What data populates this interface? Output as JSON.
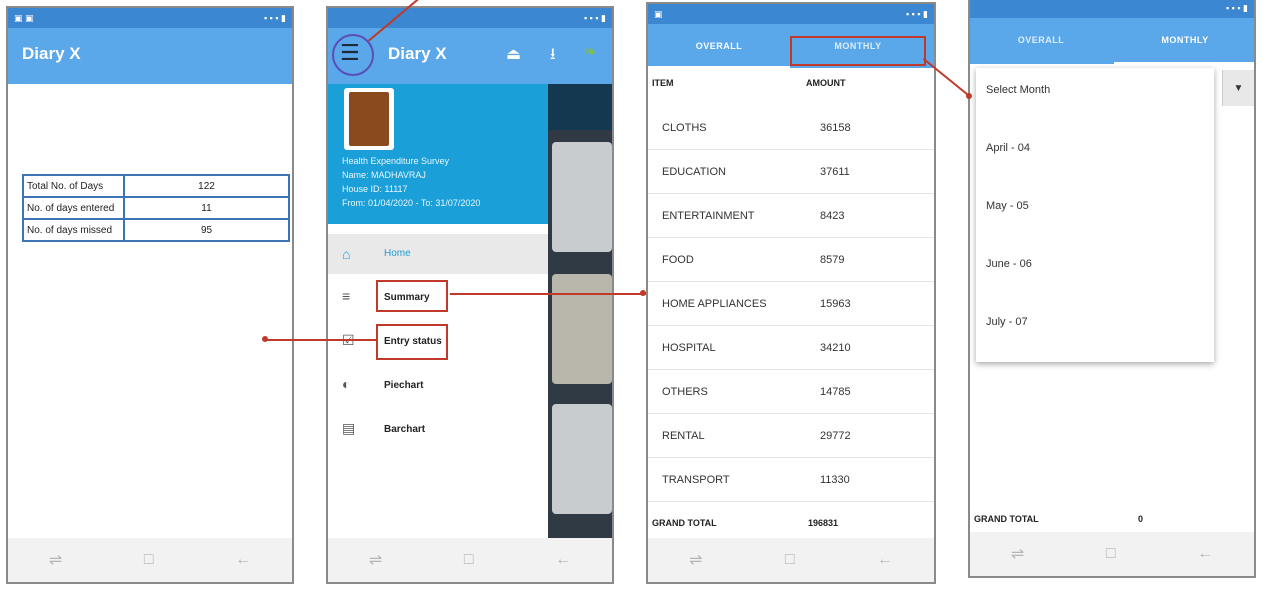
{
  "phone1": {
    "app_title": "Diary X",
    "stats": [
      {
        "label": "Total No. of Days",
        "value": "122"
      },
      {
        "label": "No. of days entered",
        "value": "11"
      },
      {
        "label": "No. of days missed",
        "value": "95"
      }
    ]
  },
  "phone2": {
    "app_title": "Diary X",
    "survey_title": "Health Expenditure Survey",
    "name": "Name: MADHAVRAJ",
    "house_id": "House ID: 11117",
    "period": "From: 01/04/2020 - To: 31/07/2020",
    "menu": {
      "home": "Home",
      "summary": "Summary",
      "entry_status": "Entry status",
      "piechart": "Piechart",
      "barchart": "Barchart"
    }
  },
  "phone3": {
    "tabs": {
      "overall": "OVERALL",
      "monthly": "MONTHLY"
    },
    "col_item": "ITEM",
    "col_amount": "AMOUNT",
    "rows": [
      {
        "item": "CLOTHS",
        "amount": "36158"
      },
      {
        "item": "EDUCATION",
        "amount": "37611"
      },
      {
        "item": "ENTERTAINMENT",
        "amount": "8423"
      },
      {
        "item": "FOOD",
        "amount": "8579"
      },
      {
        "item": "HOME APPLIANCES",
        "amount": "15963"
      },
      {
        "item": "HOSPITAL",
        "amount": "34210"
      },
      {
        "item": "OTHERS",
        "amount": "14785"
      },
      {
        "item": "RENTAL",
        "amount": "29772"
      },
      {
        "item": "TRANSPORT",
        "amount": "11330"
      }
    ],
    "grand_total_label": "GRAND TOTAL",
    "grand_total_value": "196831"
  },
  "phone4": {
    "tabs": {
      "overall": "OVERALL",
      "monthly": "MONTHLY"
    },
    "options": [
      "Select Month",
      "April - 04",
      "May - 05",
      "June - 06",
      "July - 07"
    ],
    "grand_total_label": "GRAND TOTAL",
    "grand_total_value": "0"
  },
  "colors": {
    "appbar": "#5aa7ea",
    "statusbar": "#3b87d2",
    "drawer_header": "#1a9fd8",
    "highlight": "#c0392b"
  }
}
